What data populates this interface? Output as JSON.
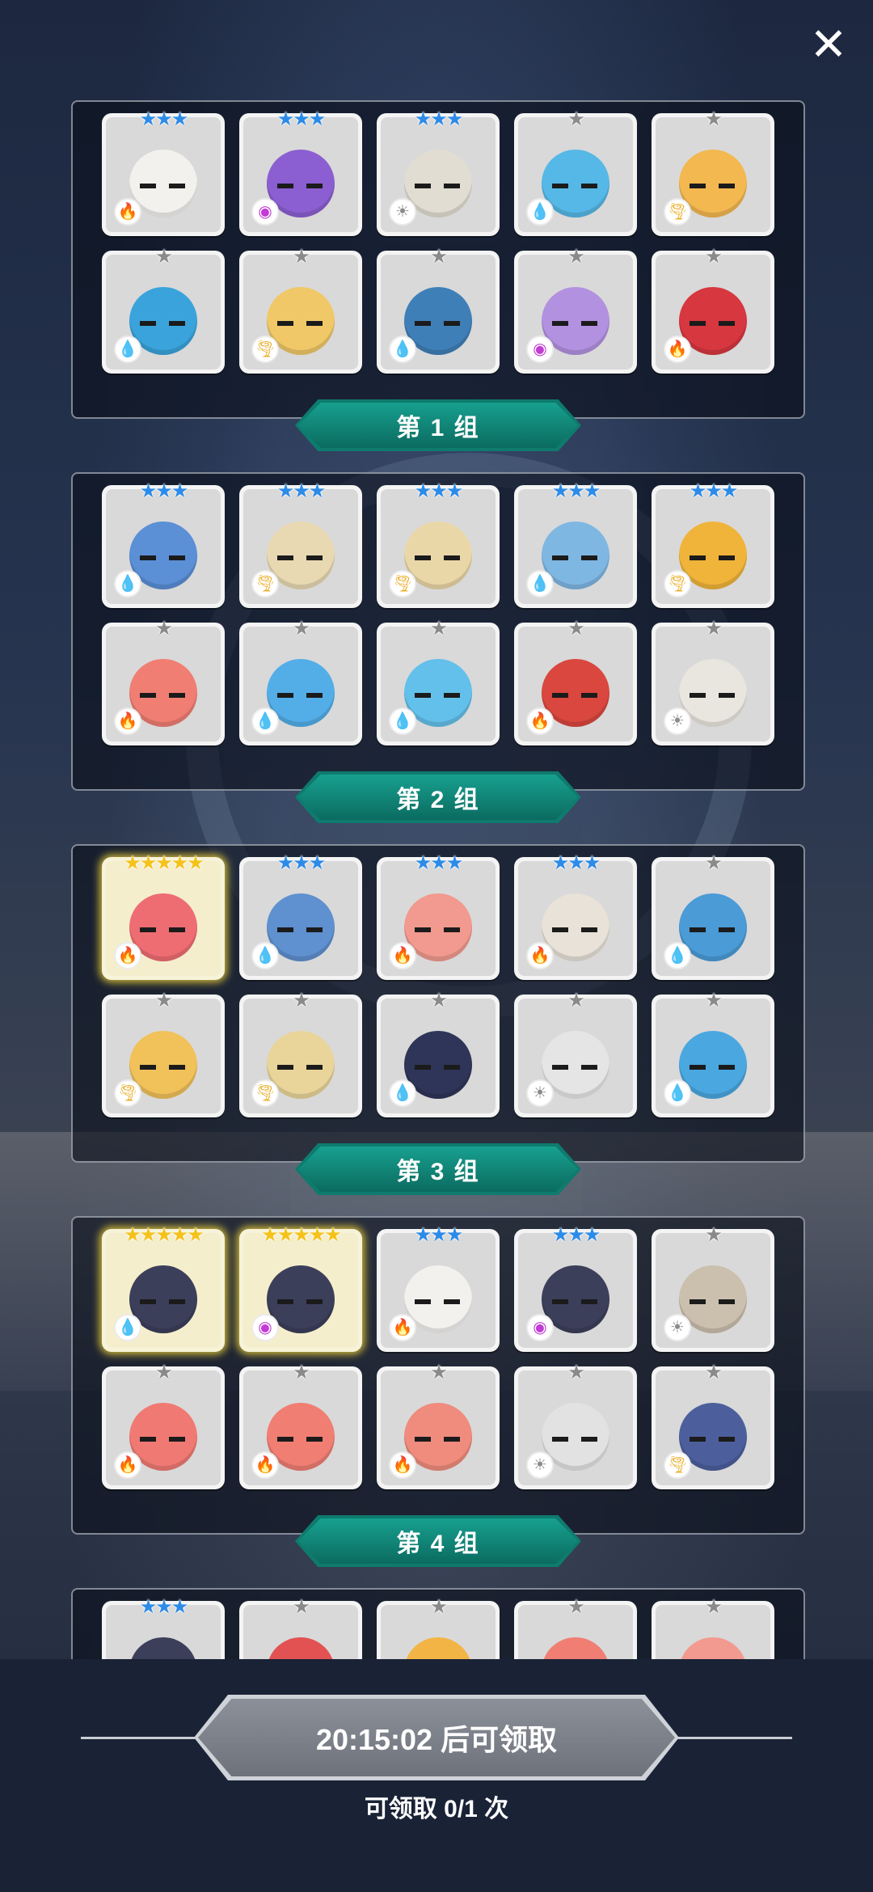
{
  "close_icon": "close-icon",
  "groups": [
    {
      "label": "第 1 组",
      "cards": [
        {
          "stars": "★★★",
          "tier": "blue",
          "elem": "fire",
          "bg": "#d9d9d9",
          "body": "#f3f1ee",
          "face": "#ffffff"
        },
        {
          "stars": "★★★",
          "tier": "blue",
          "elem": "arcane",
          "bg": "#d9d9d9",
          "body": "#8b5fd1",
          "face": "#ffffff"
        },
        {
          "stars": "★★★",
          "tier": "blue",
          "elem": "light",
          "bg": "#d9d9d9",
          "body": "#e2ddd2",
          "face": "#ffffff"
        },
        {
          "stars": "★",
          "tier": "grey",
          "elem": "water",
          "bg": "#d9d9d9",
          "body": "#56b8e6",
          "face": "#ffffff"
        },
        {
          "stars": "★",
          "tier": "grey",
          "elem": "wind",
          "bg": "#d9d9d9",
          "body": "#f3b850",
          "face": "#ffffff"
        },
        {
          "stars": "★",
          "tier": "grey",
          "elem": "water",
          "bg": "#d9d9d9",
          "body": "#3aa3db",
          "face": "#ffffff"
        },
        {
          "stars": "★",
          "tier": "grey",
          "elem": "wind",
          "bg": "#d9d9d9",
          "body": "#f0c868",
          "face": "#ffffff"
        },
        {
          "stars": "★",
          "tier": "grey",
          "elem": "water",
          "bg": "#d9d9d9",
          "body": "#3f7fb8",
          "face": "#ffffff"
        },
        {
          "stars": "★",
          "tier": "grey",
          "elem": "arcane",
          "bg": "#d9d9d9",
          "body": "#b291e0",
          "face": "#ffffff"
        },
        {
          "stars": "★",
          "tier": "grey",
          "elem": "fire",
          "bg": "#d9d9d9",
          "body": "#d7373f",
          "face": "#ffffff"
        }
      ]
    },
    {
      "label": "第 2 组",
      "cards": [
        {
          "stars": "★★★",
          "tier": "blue",
          "elem": "water",
          "bg": "#d9d9d9",
          "body": "#5b8fd6",
          "face": "#ffffff"
        },
        {
          "stars": "★★★",
          "tier": "blue",
          "elem": "wind",
          "bg": "#d9d9d9",
          "body": "#e8d9b2",
          "face": "#ffffff"
        },
        {
          "stars": "★★★",
          "tier": "blue",
          "elem": "wind",
          "bg": "#d9d9d9",
          "body": "#ead7a8",
          "face": "#ffffff"
        },
        {
          "stars": "★★★",
          "tier": "blue",
          "elem": "water",
          "bg": "#d9d9d9",
          "body": "#7fb7e3",
          "face": "#ffffff"
        },
        {
          "stars": "★★★",
          "tier": "blue",
          "elem": "wind",
          "bg": "#d9d9d9",
          "body": "#f0b43a",
          "face": "#ffffff"
        },
        {
          "stars": "★",
          "tier": "grey",
          "elem": "fire",
          "bg": "#d9d9d9",
          "body": "#f07e73",
          "face": "#ffffff"
        },
        {
          "stars": "★",
          "tier": "grey",
          "elem": "water",
          "bg": "#d9d9d9",
          "body": "#53aee8",
          "face": "#ffffff"
        },
        {
          "stars": "★",
          "tier": "grey",
          "elem": "water",
          "bg": "#d9d9d9",
          "body": "#63c0ea",
          "face": "#ffffff"
        },
        {
          "stars": "★",
          "tier": "grey",
          "elem": "fire",
          "bg": "#d9d9d9",
          "body": "#d9473f",
          "face": "#ffffff"
        },
        {
          "stars": "★",
          "tier": "grey",
          "elem": "light",
          "bg": "#d9d9d9",
          "body": "#e9e6df",
          "face": "#ffffff"
        }
      ]
    },
    {
      "label": "第 3 组",
      "cards": [
        {
          "stars": "★★★★★",
          "tier": "gold",
          "elem": "fire",
          "bg": "#f5eecd",
          "body": "#ee6d72",
          "face": "#ffffff",
          "gold": true
        },
        {
          "stars": "★★★",
          "tier": "blue",
          "elem": "water",
          "bg": "#d9d9d9",
          "body": "#5f90cf",
          "face": "#ffffff"
        },
        {
          "stars": "★★★",
          "tier": "blue",
          "elem": "fire",
          "bg": "#d9d9d9",
          "body": "#f29a8f",
          "face": "#ffffff"
        },
        {
          "stars": "★★★",
          "tier": "blue",
          "elem": "fire",
          "bg": "#d9d9d9",
          "body": "#e8e2d8",
          "face": "#ffffff"
        },
        {
          "stars": "★",
          "tier": "grey",
          "elem": "water",
          "bg": "#d9d9d9",
          "body": "#4a9bd6",
          "face": "#ffffff"
        },
        {
          "stars": "★",
          "tier": "grey",
          "elem": "wind",
          "bg": "#d9d9d9",
          "body": "#f1c15a",
          "face": "#ffffff"
        },
        {
          "stars": "★",
          "tier": "grey",
          "elem": "wind",
          "bg": "#d9d9d9",
          "body": "#e9d49a",
          "face": "#ffffff"
        },
        {
          "stars": "★",
          "tier": "grey",
          "elem": "water",
          "bg": "#d9d9d9",
          "body": "#2f3558",
          "face": "#ffffff"
        },
        {
          "stars": "★",
          "tier": "grey",
          "elem": "light",
          "bg": "#d9d9d9",
          "body": "#e5e5e5",
          "face": "#ffffff"
        },
        {
          "stars": "★",
          "tier": "grey",
          "elem": "water",
          "bg": "#d9d9d9",
          "body": "#4aa7e0",
          "face": "#ffffff"
        }
      ]
    },
    {
      "label": "第 4 组",
      "cards": [
        {
          "stars": "★★★★★",
          "tier": "gold",
          "elem": "water",
          "bg": "#f5eecd",
          "body": "#3c3f5a",
          "face": "#ffffff",
          "gold": true
        },
        {
          "stars": "★★★★★",
          "tier": "gold",
          "elem": "arcane",
          "bg": "#f5eecd",
          "body": "#3c3f5a",
          "face": "#ffffff",
          "gold": true
        },
        {
          "stars": "★★★",
          "tier": "blue",
          "elem": "fire",
          "bg": "#d9d9d9",
          "body": "#f3f1ee",
          "face": "#ffffff"
        },
        {
          "stars": "★★★",
          "tier": "blue",
          "elem": "arcane",
          "bg": "#d9d9d9",
          "body": "#3c3f5a",
          "face": "#ffffff"
        },
        {
          "stars": "★",
          "tier": "grey",
          "elem": "light",
          "bg": "#d9d9d9",
          "body": "#cbbfae",
          "face": "#ffffff"
        },
        {
          "stars": "★",
          "tier": "grey",
          "elem": "fire",
          "bg": "#d9d9d9",
          "body": "#f07a73",
          "face": "#ffffff"
        },
        {
          "stars": "★",
          "tier": "grey",
          "elem": "fire",
          "bg": "#d9d9d9",
          "body": "#f07e73",
          "face": "#ffffff"
        },
        {
          "stars": "★",
          "tier": "grey",
          "elem": "fire",
          "bg": "#d9d9d9",
          "body": "#ef8c7d",
          "face": "#ffffff"
        },
        {
          "stars": "★",
          "tier": "grey",
          "elem": "light",
          "bg": "#d9d9d9",
          "body": "#e2e2e2",
          "face": "#ffffff"
        },
        {
          "stars": "★",
          "tier": "grey",
          "elem": "wind",
          "bg": "#d9d9d9",
          "body": "#4c5f9c",
          "face": "#ffffff"
        }
      ]
    },
    {
      "label": "",
      "cards": [
        {
          "stars": "★★★",
          "tier": "blue",
          "elem": "",
          "bg": "#d9d9d9",
          "body": "#3c3f5a",
          "face": "#ffffff"
        },
        {
          "stars": "★",
          "tier": "grey",
          "elem": "",
          "bg": "#d9d9d9",
          "body": "#e25252",
          "face": "#ffffff"
        },
        {
          "stars": "★",
          "tier": "grey",
          "elem": "",
          "bg": "#d9d9d9",
          "body": "#f2b545",
          "face": "#ffffff"
        },
        {
          "stars": "★",
          "tier": "grey",
          "elem": "",
          "bg": "#d9d9d9",
          "body": "#f07e73",
          "face": "#ffffff"
        },
        {
          "stars": "★",
          "tier": "grey",
          "elem": "",
          "bg": "#d9d9d9",
          "body": "#f29a8f",
          "face": "#ffffff"
        }
      ]
    }
  ],
  "element_icons": {
    "fire": {
      "glyph": "🔥",
      "color": "#e8412f"
    },
    "water": {
      "glyph": "💧",
      "color": "#2f8fe0"
    },
    "wind": {
      "glyph": "🌪",
      "color": "#e9a81a"
    },
    "light": {
      "glyph": "☀",
      "color": "#8a8a8a"
    },
    "arcane": {
      "glyph": "◉",
      "color": "#c23bd4"
    }
  },
  "footer": {
    "claim_button_label": "20:15:02 后可领取",
    "claim_count_text": "可领取 0/1 次"
  }
}
